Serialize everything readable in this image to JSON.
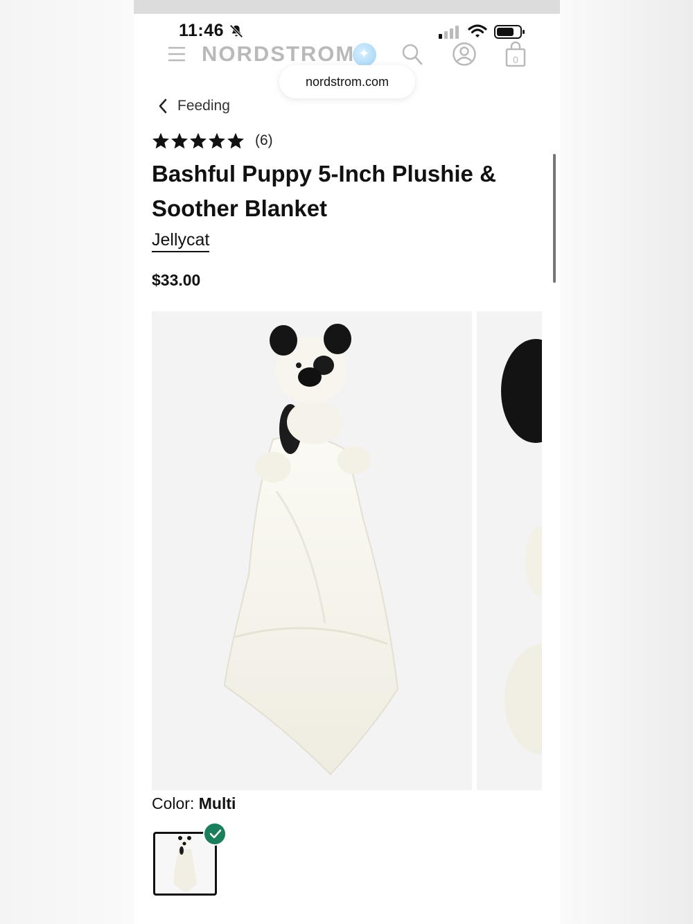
{
  "status_bar": {
    "time": "11:46",
    "icons": [
      "bell-slash-icon",
      "signal-icon",
      "wifi-icon",
      "battery-icon"
    ]
  },
  "header": {
    "logo": "NORDSTROM",
    "icons": [
      "hamburger-menu-icon",
      "sparkle-assistant-icon",
      "search-icon",
      "account-icon",
      "shopping-bag-icon"
    ],
    "bag_count": "0"
  },
  "browser": {
    "url": "nordstrom.com"
  },
  "breadcrumb": {
    "back_label": "Feeding"
  },
  "product": {
    "rating_stars": 5,
    "review_count": "(6)",
    "title": "Bashful Puppy 5-Inch Plushie & Soother Blanket",
    "brand": "Jellycat",
    "price": "$33.00",
    "color_label": "Color:",
    "color_value": "Multi"
  },
  "colors": {
    "selected_check": "#1a7f5a",
    "logo_gray": "#b9b9b9"
  }
}
